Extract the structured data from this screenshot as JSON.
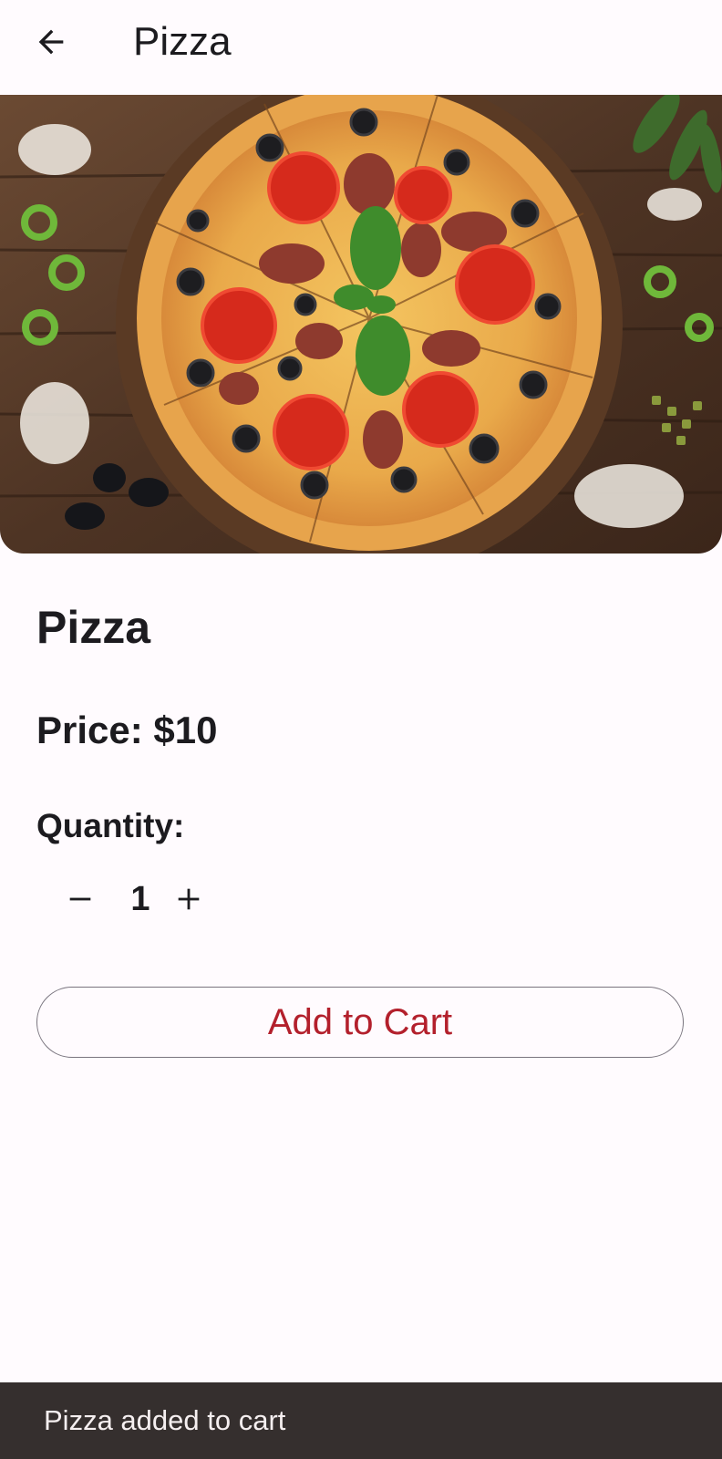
{
  "app_bar": {
    "back_icon": "arrow-back-icon",
    "title": "Pizza"
  },
  "product": {
    "image_alt_icon": "pizza-image",
    "name": "Pizza",
    "price_text": "Price: $10"
  },
  "quantity": {
    "label": "Quantity:",
    "value": "1",
    "decrement_icon": "minus-icon",
    "increment_icon": "plus-icon"
  },
  "actions": {
    "add_to_cart_label": "Add to Cart"
  },
  "snackbar": {
    "message": "Pizza added to cart"
  },
  "colors": {
    "background": "#fffbfe",
    "accent": "#b3202c",
    "snackbar": "#352f2e",
    "outline": "#79747e"
  }
}
